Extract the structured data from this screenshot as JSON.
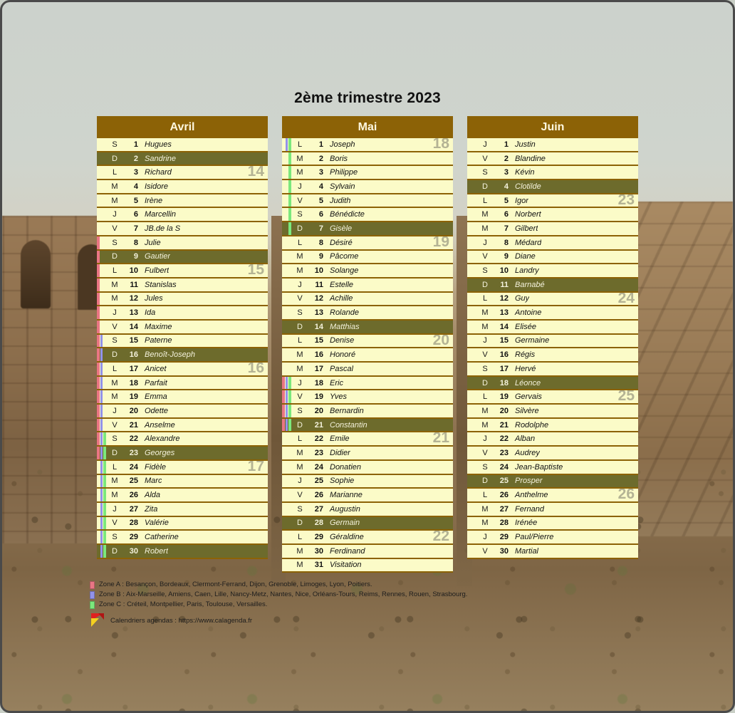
{
  "title": "2ème trimestre 2023",
  "colors": {
    "header_brown": "#8c6206",
    "day_bg": "#fbfbc8",
    "sunday_bg": "#6d6b2c",
    "zone_a": "#ea7684",
    "zone_b": "#9292ea",
    "zone_c": "#7ce87c",
    "week_number": "#6e6c60"
  },
  "months": [
    {
      "name": "Avril",
      "days": [
        {
          "dow": "S",
          "num": "1",
          "saint": "Hugues",
          "week": "",
          "zones": []
        },
        {
          "dow": "D",
          "num": "2",
          "saint": "Sandrine",
          "week": "",
          "zones": []
        },
        {
          "dow": "L",
          "num": "3",
          "saint": "Richard",
          "week": "14",
          "zones": []
        },
        {
          "dow": "M",
          "num": "4",
          "saint": "Isidore",
          "week": "",
          "zones": []
        },
        {
          "dow": "M",
          "num": "5",
          "saint": "Irène",
          "week": "",
          "zones": []
        },
        {
          "dow": "J",
          "num": "6",
          "saint": "Marcellin",
          "week": "",
          "zones": []
        },
        {
          "dow": "V",
          "num": "7",
          "saint": "JB.de la S",
          "week": "",
          "zones": []
        },
        {
          "dow": "S",
          "num": "8",
          "saint": "Julie",
          "week": "",
          "zones": [
            "A"
          ]
        },
        {
          "dow": "D",
          "num": "9",
          "saint": "Gautier",
          "week": "",
          "zones": [
            "A"
          ]
        },
        {
          "dow": "L",
          "num": "10",
          "saint": "Fulbert",
          "week": "15",
          "zones": [
            "A"
          ]
        },
        {
          "dow": "M",
          "num": "11",
          "saint": "Stanislas",
          "week": "",
          "zones": [
            "A"
          ]
        },
        {
          "dow": "M",
          "num": "12",
          "saint": "Jules",
          "week": "",
          "zones": [
            "A"
          ]
        },
        {
          "dow": "J",
          "num": "13",
          "saint": "Ida",
          "week": "",
          "zones": [
            "A"
          ]
        },
        {
          "dow": "V",
          "num": "14",
          "saint": "Maxime",
          "week": "",
          "zones": [
            "A"
          ]
        },
        {
          "dow": "S",
          "num": "15",
          "saint": "Paterne",
          "week": "",
          "zones": [
            "A",
            "B"
          ]
        },
        {
          "dow": "D",
          "num": "16",
          "saint": "Benoît-Joseph",
          "week": "",
          "zones": [
            "A",
            "B"
          ]
        },
        {
          "dow": "L",
          "num": "17",
          "saint": "Anicet",
          "week": "16",
          "zones": [
            "A",
            "B"
          ]
        },
        {
          "dow": "M",
          "num": "18",
          "saint": "Parfait",
          "week": "",
          "zones": [
            "A",
            "B"
          ]
        },
        {
          "dow": "M",
          "num": "19",
          "saint": "Emma",
          "week": "",
          "zones": [
            "A",
            "B"
          ]
        },
        {
          "dow": "J",
          "num": "20",
          "saint": "Odette",
          "week": "",
          "zones": [
            "A",
            "B"
          ]
        },
        {
          "dow": "V",
          "num": "21",
          "saint": "Anselme",
          "week": "",
          "zones": [
            "A",
            "B"
          ]
        },
        {
          "dow": "S",
          "num": "22",
          "saint": "Alexandre",
          "week": "",
          "zones": [
            "A",
            "B",
            "C"
          ]
        },
        {
          "dow": "D",
          "num": "23",
          "saint": "Georges",
          "week": "",
          "zones": [
            "A",
            "B",
            "C"
          ]
        },
        {
          "dow": "L",
          "num": "24",
          "saint": "Fidèle",
          "week": "17",
          "zones": [
            "",
            "B",
            "C"
          ]
        },
        {
          "dow": "M",
          "num": "25",
          "saint": "Marc",
          "week": "",
          "zones": [
            "",
            "B",
            "C"
          ]
        },
        {
          "dow": "M",
          "num": "26",
          "saint": "Alda",
          "week": "",
          "zones": [
            "",
            "B",
            "C"
          ]
        },
        {
          "dow": "J",
          "num": "27",
          "saint": "Zita",
          "week": "",
          "zones": [
            "",
            "B",
            "C"
          ]
        },
        {
          "dow": "V",
          "num": "28",
          "saint": "Valérie",
          "week": "",
          "zones": [
            "",
            "B",
            "C"
          ]
        },
        {
          "dow": "S",
          "num": "29",
          "saint": "Catherine",
          "week": "",
          "zones": [
            "",
            "B",
            "C"
          ]
        },
        {
          "dow": "D",
          "num": "30",
          "saint": "Robert",
          "week": "",
          "zones": [
            "",
            "B",
            "C"
          ]
        }
      ]
    },
    {
      "name": "Mai",
      "days": [
        {
          "dow": "L",
          "num": "1",
          "saint": "Joseph",
          "week": "18",
          "zones": [
            "",
            "B",
            "C"
          ]
        },
        {
          "dow": "M",
          "num": "2",
          "saint": "Boris",
          "week": "",
          "zones": [
            "",
            "",
            "C"
          ]
        },
        {
          "dow": "M",
          "num": "3",
          "saint": "Philippe",
          "week": "",
          "zones": [
            "",
            "",
            "C"
          ]
        },
        {
          "dow": "J",
          "num": "4",
          "saint": "Sylvain",
          "week": "",
          "zones": [
            "",
            "",
            "C"
          ]
        },
        {
          "dow": "V",
          "num": "5",
          "saint": "Judith",
          "week": "",
          "zones": [
            "",
            "",
            "C"
          ]
        },
        {
          "dow": "S",
          "num": "6",
          "saint": "Bénédicte",
          "week": "",
          "zones": [
            "",
            "",
            "C"
          ]
        },
        {
          "dow": "D",
          "num": "7",
          "saint": "Gisèle",
          "week": "",
          "zones": [
            "",
            "",
            "C"
          ]
        },
        {
          "dow": "L",
          "num": "8",
          "saint": "Désiré",
          "week": "19",
          "zones": []
        },
        {
          "dow": "M",
          "num": "9",
          "saint": "Pâcome",
          "week": "",
          "zones": []
        },
        {
          "dow": "M",
          "num": "10",
          "saint": "Solange",
          "week": "",
          "zones": []
        },
        {
          "dow": "J",
          "num": "11",
          "saint": "Estelle",
          "week": "",
          "zones": []
        },
        {
          "dow": "V",
          "num": "12",
          "saint": "Achille",
          "week": "",
          "zones": []
        },
        {
          "dow": "S",
          "num": "13",
          "saint": "Rolande",
          "week": "",
          "zones": []
        },
        {
          "dow": "D",
          "num": "14",
          "saint": "Matthias",
          "week": "",
          "zones": []
        },
        {
          "dow": "L",
          "num": "15",
          "saint": "Denise",
          "week": "20",
          "zones": []
        },
        {
          "dow": "M",
          "num": "16",
          "saint": "Honoré",
          "week": "",
          "zones": []
        },
        {
          "dow": "M",
          "num": "17",
          "saint": "Pascal",
          "week": "",
          "zones": []
        },
        {
          "dow": "J",
          "num": "18",
          "saint": "Eric",
          "week": "",
          "zones": [
            "A",
            "B",
            "C"
          ]
        },
        {
          "dow": "V",
          "num": "19",
          "saint": "Yves",
          "week": "",
          "zones": [
            "A",
            "B",
            "C"
          ]
        },
        {
          "dow": "S",
          "num": "20",
          "saint": "Bernardin",
          "week": "",
          "zones": [
            "A",
            "B",
            "C"
          ]
        },
        {
          "dow": "D",
          "num": "21",
          "saint": "Constantin",
          "week": "",
          "zones": [
            "A",
            "B",
            "C"
          ]
        },
        {
          "dow": "L",
          "num": "22",
          "saint": "Emile",
          "week": "21",
          "zones": []
        },
        {
          "dow": "M",
          "num": "23",
          "saint": "Didier",
          "week": "",
          "zones": []
        },
        {
          "dow": "M",
          "num": "24",
          "saint": "Donatien",
          "week": "",
          "zones": []
        },
        {
          "dow": "J",
          "num": "25",
          "saint": "Sophie",
          "week": "",
          "zones": []
        },
        {
          "dow": "V",
          "num": "26",
          "saint": "Marianne",
          "week": "",
          "zones": []
        },
        {
          "dow": "S",
          "num": "27",
          "saint": "Augustin",
          "week": "",
          "zones": []
        },
        {
          "dow": "D",
          "num": "28",
          "saint": "Germain",
          "week": "",
          "zones": []
        },
        {
          "dow": "L",
          "num": "29",
          "saint": "Géraldine",
          "week": "22",
          "zones": []
        },
        {
          "dow": "M",
          "num": "30",
          "saint": "Ferdinand",
          "week": "",
          "zones": []
        },
        {
          "dow": "M",
          "num": "31",
          "saint": "Visitation",
          "week": "",
          "zones": []
        }
      ]
    },
    {
      "name": "Juin",
      "days": [
        {
          "dow": "J",
          "num": "1",
          "saint": "Justin",
          "week": "",
          "zones": []
        },
        {
          "dow": "V",
          "num": "2",
          "saint": "Blandine",
          "week": "",
          "zones": []
        },
        {
          "dow": "S",
          "num": "3",
          "saint": "Kévin",
          "week": "",
          "zones": []
        },
        {
          "dow": "D",
          "num": "4",
          "saint": "Clotilde",
          "week": "",
          "zones": []
        },
        {
          "dow": "L",
          "num": "5",
          "saint": "Igor",
          "week": "23",
          "zones": []
        },
        {
          "dow": "M",
          "num": "6",
          "saint": "Norbert",
          "week": "",
          "zones": []
        },
        {
          "dow": "M",
          "num": "7",
          "saint": "Gilbert",
          "week": "",
          "zones": []
        },
        {
          "dow": "J",
          "num": "8",
          "saint": "Médard",
          "week": "",
          "zones": []
        },
        {
          "dow": "V",
          "num": "9",
          "saint": "Diane",
          "week": "",
          "zones": []
        },
        {
          "dow": "S",
          "num": "10",
          "saint": "Landry",
          "week": "",
          "zones": []
        },
        {
          "dow": "D",
          "num": "11",
          "saint": "Barnabé",
          "week": "",
          "zones": []
        },
        {
          "dow": "L",
          "num": "12",
          "saint": "Guy",
          "week": "24",
          "zones": []
        },
        {
          "dow": "M",
          "num": "13",
          "saint": "Antoine",
          "week": "",
          "zones": []
        },
        {
          "dow": "M",
          "num": "14",
          "saint": "Elisée",
          "week": "",
          "zones": []
        },
        {
          "dow": "J",
          "num": "15",
          "saint": "Germaine",
          "week": "",
          "zones": []
        },
        {
          "dow": "V",
          "num": "16",
          "saint": "Régis",
          "week": "",
          "zones": []
        },
        {
          "dow": "S",
          "num": "17",
          "saint": "Hervé",
          "week": "",
          "zones": []
        },
        {
          "dow": "D",
          "num": "18",
          "saint": "Léonce",
          "week": "",
          "zones": []
        },
        {
          "dow": "L",
          "num": "19",
          "saint": "Gervais",
          "week": "25",
          "zones": []
        },
        {
          "dow": "M",
          "num": "20",
          "saint": "Silvère",
          "week": "",
          "zones": []
        },
        {
          "dow": "M",
          "num": "21",
          "saint": "Rodolphe",
          "week": "",
          "zones": []
        },
        {
          "dow": "J",
          "num": "22",
          "saint": "Alban",
          "week": "",
          "zones": []
        },
        {
          "dow": "V",
          "num": "23",
          "saint": "Audrey",
          "week": "",
          "zones": []
        },
        {
          "dow": "S",
          "num": "24",
          "saint": "Jean-Baptiste",
          "week": "",
          "zones": []
        },
        {
          "dow": "D",
          "num": "25",
          "saint": "Prosper",
          "week": "",
          "zones": []
        },
        {
          "dow": "L",
          "num": "26",
          "saint": "Anthelme",
          "week": "26",
          "zones": []
        },
        {
          "dow": "M",
          "num": "27",
          "saint": "Fernand",
          "week": "",
          "zones": []
        },
        {
          "dow": "M",
          "num": "28",
          "saint": "Irénée",
          "week": "",
          "zones": []
        },
        {
          "dow": "J",
          "num": "29",
          "saint": "Paul/Pierre",
          "week": "",
          "zones": []
        },
        {
          "dow": "V",
          "num": "30",
          "saint": "Martial",
          "week": "",
          "zones": []
        }
      ]
    }
  ],
  "legend": [
    {
      "zone": "A",
      "color": "#ea7684",
      "text": "Zone A : Besançon, Bordeaux, Clermont-Ferrand, Dijon, Grenoble, Limoges, Lyon, Poitiers."
    },
    {
      "zone": "B",
      "color": "#9292ea",
      "text": "Zone B : Aix-Marseille, Amiens, Caen, Lille, Nancy-Metz, Nantes, Nice, Orléans-Tours, Reims, Rennes, Rouen, Strasbourg."
    },
    {
      "zone": "C",
      "color": "#7ce87c",
      "text": "Zone C : Créteil, Montpellier, Paris, Toulouse, Versailles."
    }
  ],
  "credit": "Calendriers agendas : https://www.calagenda.fr"
}
